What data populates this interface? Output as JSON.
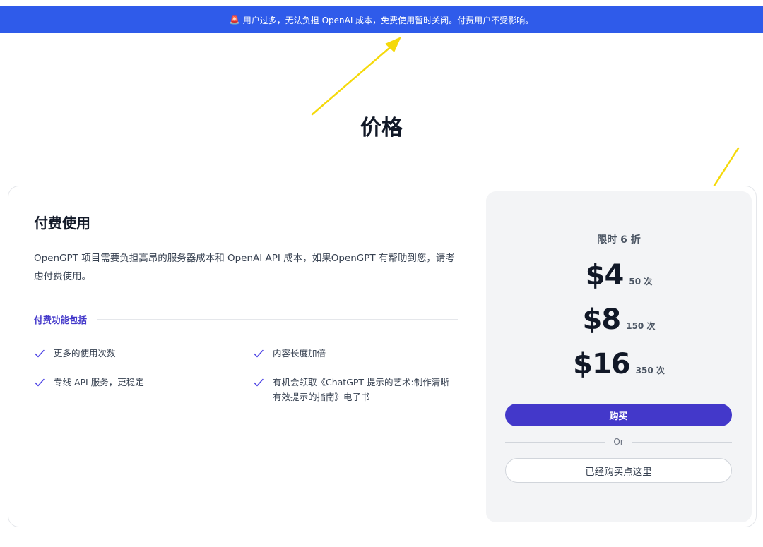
{
  "banner": {
    "icon": "warning-light-icon",
    "text": "用户过多，无法负担 OpenAI 成本，免费使用暂时关闭。付费用户不受影响。"
  },
  "page": {
    "title": "价格"
  },
  "plan": {
    "title": "付费使用",
    "description": "OpenGPT 项目需要负担高昂的服务器成本和 OpenAI API 成本，如果OpenGPT 有帮助到您，请考虑付费使用。",
    "features_heading": "付费功能包括",
    "features": [
      "更多的使用次数",
      "内容长度加倍",
      "专线 API 服务，更稳定",
      "有机会领取《ChatGPT 提示的艺术:制作清晰有效提示的指南》电子书"
    ]
  },
  "pricing": {
    "promo": "限时 6 折",
    "tiers": [
      {
        "price": "$4",
        "count": "50 次"
      },
      {
        "price": "$8",
        "count": "150 次"
      },
      {
        "price": "$16",
        "count": "350 次"
      }
    ],
    "buy_label": "购买",
    "or_label": "Or",
    "bought_label": "已经购买点这里"
  },
  "colors": {
    "banner_bg": "#2f5bea",
    "accent": "#4338ca",
    "annotation_arrow": "#f5d90a"
  }
}
